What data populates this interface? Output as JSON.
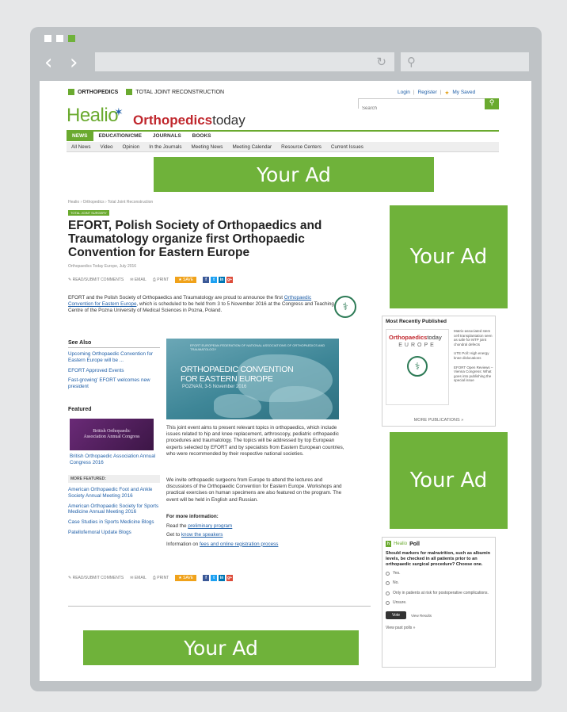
{
  "browser": {
    "dot_colors": [
      "#ffffff",
      "#ffffff",
      "#6fb23a"
    ],
    "back_icon": "chevron-left-icon",
    "forward_icon": "chevron-right-icon",
    "reload_icon": "reload-icon",
    "search_icon": "search-icon"
  },
  "header": {
    "tags": [
      "ORTHOPEDICS",
      "TOTAL JOINT RECONSTRUCTION"
    ],
    "login": "Login",
    "register": "Register",
    "my_saved": "My Saved",
    "search_placeholder": "Search",
    "logo_healio": "Healio",
    "logo_brand_bold": "Orthopedics",
    "logo_brand_light": "today",
    "main_nav": [
      "NEWS",
      "EDUCATION/CME",
      "JOURNALS",
      "BOOKS"
    ],
    "sub_nav": [
      "All News",
      "Video",
      "Opinion",
      "In the Journals",
      "Meeting News",
      "Meeting Calendar",
      "Resource Centers",
      "Current Issues"
    ]
  },
  "ads": {
    "top": "Your Ad",
    "right1": "Your Ad",
    "right2": "Your Ad",
    "bottom": "Your Ad"
  },
  "article": {
    "breadcrumb": "Healio  ›  Orthopedics  ›  Total Joint Reconstruction",
    "badge": "TOTAL JOINT SURGERY",
    "headline": "EFORT, Polish Society of Orthopaedics and Traumatology organize first Orthopaedic Convention for Eastern Europe",
    "byline": "Orthopaedics Today Europe, July 2016",
    "share": {
      "comments": "READ/SUBMIT COMMENTS",
      "email": "EMAIL",
      "print": "PRINT",
      "save": "SAVE"
    },
    "intro_a": "EFORT and the Polish Society of Orthopaedics and Traumatology are proud to announce the first ",
    "intro_link": "Orthopaedic Convention for Eastern Europe",
    "intro_b": ", which is scheduled to be held from 3 to 5 November 2016 at the Congress and Teaching Centre of the Pozna University of Medical Sciences in Pozna, Poland.",
    "image": {
      "top_text": "EFORT EUROPEAN FEDERATION OF NATIONAL ASSOCIATIONS OF ORTHOPAEDICS AND TRAUMATOLOGY",
      "title_line1": "ORTHOPAEDIC CONVENTION",
      "title_line2": "FOR EASTERN EUROPE",
      "date": "POZNAŃ, 3-5 November 2016"
    },
    "para1": "This joint event aims to present relevant topics in orthopaedics, which include issues related to hip and knee replacement, arthroscopy, pediatric orthopaedic procedures and traumatology. The topics will be addressed by top European experts selected by EFORT and by specialists from Eastern European countries, who were recommended by their respective national societies.",
    "para2": "We invite orthopaedic surgeons from Europe to attend the lectures and discussions of the Orthopaedic Convention for Eastern Europe. Workshops and practical exercises on human specimens are also featured on the program. The event will be held in English and Russian.",
    "more_info_heading": "For more information:",
    "info_lines": [
      {
        "pre": "Read the ",
        "link": "preliminary program"
      },
      {
        "pre": "Get to ",
        "link": "know the speakers"
      },
      {
        "pre": "Information on ",
        "link": "fees and online registration process"
      }
    ]
  },
  "left_rail": {
    "see_also_title": "See Also",
    "see_also": [
      "Upcoming Orthopaedic Convention for Eastern Europe will be ...",
      "EFORT Approved Events",
      "Fast-growing' EFORT welcomes new president"
    ],
    "featured_title": "Featured",
    "featured_image_line1": "British Orthopaedic",
    "featured_image_line2": "Association Annual Congress",
    "featured_caption": "British Orthopaedic Association Annual Congress 2016",
    "more_featured_title": "MORE FEATURED:",
    "more_featured": [
      "American Orthopaedic Foot and Ankle Society Annual Meeting 2016",
      "American Orthopaedic Society for Sports Medicine Annual Meeting 2016",
      "Case Studies in Sports Medicine Blogs",
      "Patellofemoral Update Blogs"
    ]
  },
  "right_rail": {
    "mrp_title": "Most Recently Published",
    "cover_brand_bold": "Orthopaedics",
    "cover_brand_light": "today",
    "cover_region": "EUROPE",
    "mrp_items": [
      "Matrix-associated stem cell transplantation seen as safe for MTP joint chondral defects",
      "UTE Poll: High energy knee dislocations",
      "EFORT Open Reviews – Vienna Congress: What goes into publishing the special issue"
    ],
    "mrp_more": "MORE PUBLICATIONS »",
    "poll_logo": "h",
    "poll_brand": "Healio",
    "poll_title": "Poll",
    "poll_question": "Should markers for malnutrition, such as albumin levels, be checked in all patients prior to an orthopaedic surgical procedure? Choose one.",
    "poll_options": [
      "Yes.",
      "No.",
      "Only in patients at risk for postoperative complications.",
      "Unsure."
    ],
    "vote": "Vote",
    "view_results": "View Results",
    "past_polls": "View past polls »"
  }
}
